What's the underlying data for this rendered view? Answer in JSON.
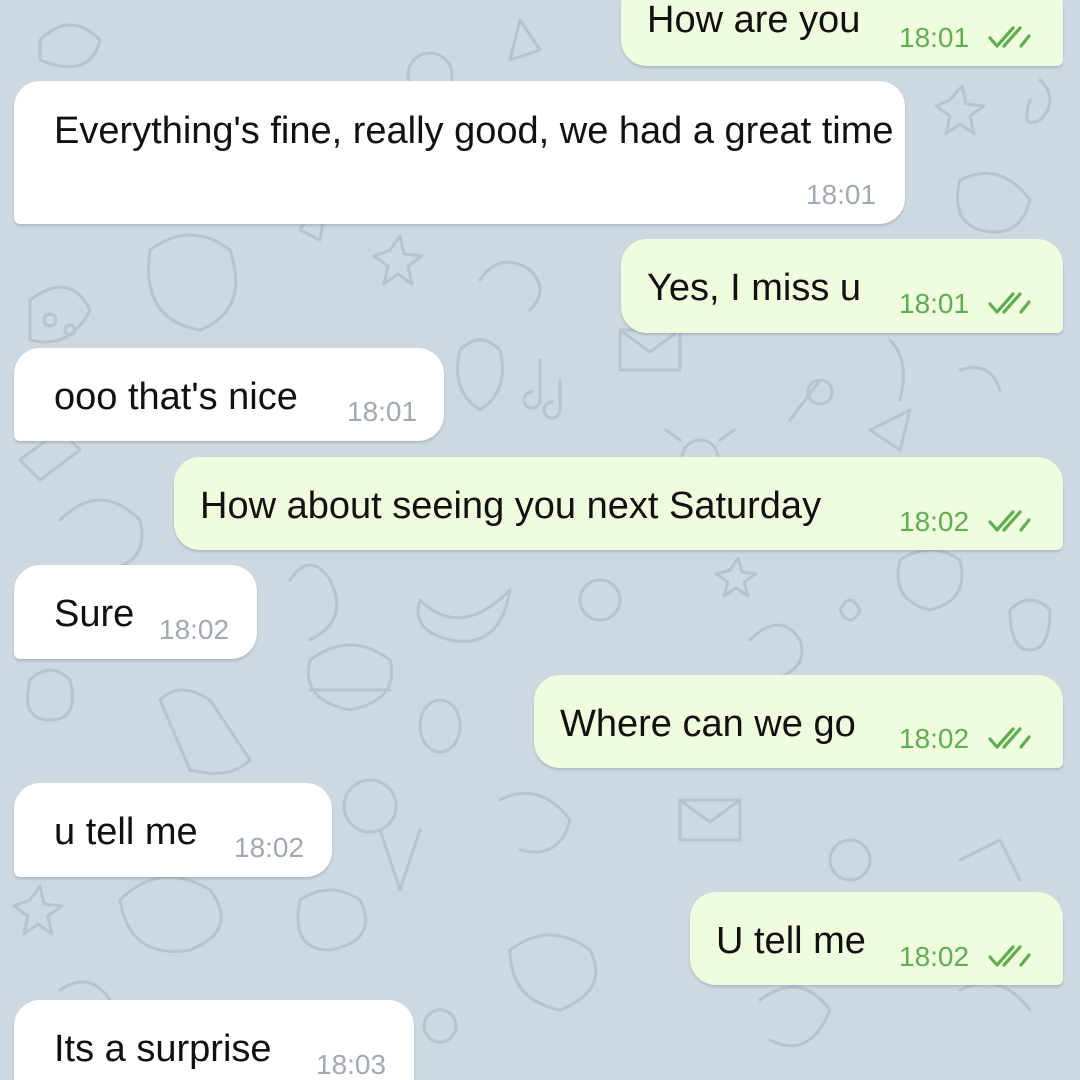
{
  "colors": {
    "chat_background": "#cdd8e0",
    "incoming_bubble": "#ffffff",
    "outgoing_bubble": "#effdde",
    "incoming_time": "#a1aab3",
    "outgoing_time": "#5fae50",
    "read_ticks": "#5fae50"
  },
  "icons": {
    "read_status": "double-check-icon"
  },
  "messages": [
    {
      "direction": "out",
      "text": "How are you",
      "time": "18:01",
      "status": "read"
    },
    {
      "direction": "in",
      "text": "Everything's fine, really good, we had a great time",
      "time": "18:01"
    },
    {
      "direction": "out",
      "text": "Yes, I miss u",
      "time": "18:01",
      "status": "read"
    },
    {
      "direction": "in",
      "text": "ooo that's nice",
      "time": "18:01"
    },
    {
      "direction": "out",
      "text": "How about seeing you next Saturday",
      "time": "18:02",
      "status": "read"
    },
    {
      "direction": "in",
      "text": "Sure",
      "time": "18:02"
    },
    {
      "direction": "out",
      "text": "Where can we go",
      "time": "18:02",
      "status": "read"
    },
    {
      "direction": "in",
      "text": "u tell me",
      "time": "18:02"
    },
    {
      "direction": "out",
      "text": "U tell me",
      "time": "18:02",
      "status": "read"
    },
    {
      "direction": "in",
      "text": "Its a surprise",
      "time": "18:03"
    }
  ]
}
